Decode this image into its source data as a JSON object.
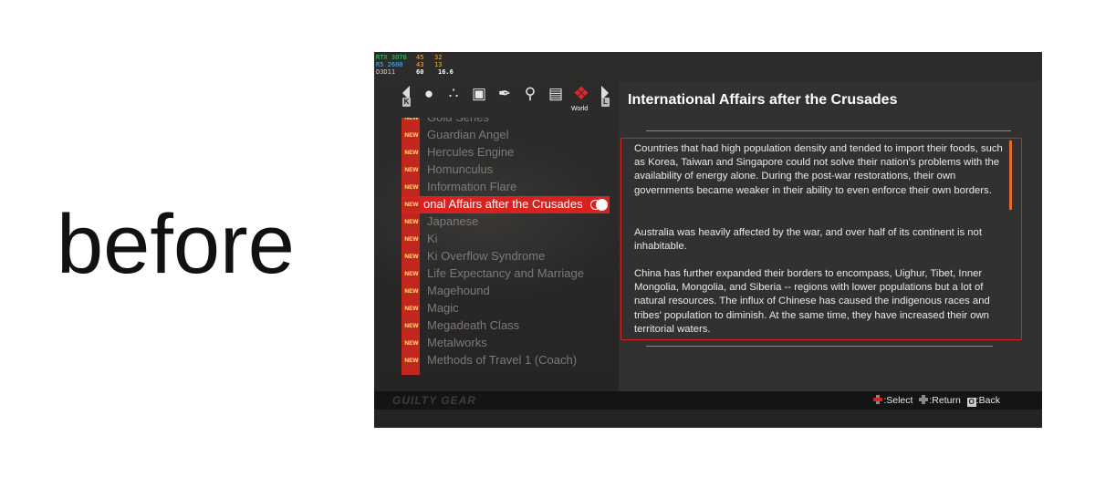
{
  "caption": "before",
  "perf": {
    "gpu": "RTX 3070",
    "gpu_temp": "45",
    "gpu_load": "32",
    "cpu": "R5 2600",
    "cpu_temp": "43",
    "cpu_load": "13",
    "api": "D3D11",
    "fps": "60",
    "frametime": "16.6"
  },
  "nav": {
    "left_key": "K",
    "right_key": "L",
    "active_category": "World",
    "icons": [
      "character-icon",
      "network-icon",
      "gallery-icon",
      "feather-icon",
      "magnifier-icon",
      "scroll-icon",
      "world-icon"
    ]
  },
  "list": {
    "badge": "NEW",
    "items": [
      "Gold Series",
      "Guardian Angel",
      "Hercules Engine",
      "Homunculus",
      "Information Flare",
      "onal Affairs after the Crusades",
      "Japanese",
      "Ki",
      "Ki Overflow Syndrome",
      "Life Expectancy and Marriage",
      "Magehound",
      "Magic",
      "Megadeath Class",
      "Metalworks",
      "Methods of Travel 1 (Coach)"
    ],
    "selected_index": 5
  },
  "article": {
    "title": "International Affairs after the Crusades",
    "paragraphs": [
      "Countries that had high population density and tended to import their foods, such as Korea, Taiwan and Singapore could not solve their nation's problems with the availability of energy alone. During the post-war restorations, their own governments became weaker in their ability to even enforce their own borders.",
      "Australia was heavily affected by the war, and over half of its continent is not inhabitable.",
      "China has further expanded their borders to encompass, Uighur, Tibet, Inner Mongolia, Mongolia, and Siberia -- regions with lower populations but a lot of natural resources. The influx of Chinese has caused the indigenous races and tribes' population to diminish. At the same time, they have increased their own territorial waters."
    ]
  },
  "footer": {
    "logo": "GUILTY GEAR",
    "select": ":Select",
    "return": ":Return",
    "back": ":Back",
    "back_key": "O"
  },
  "colors": {
    "accent_red": "#d7231f",
    "badge_text": "#ffe36b",
    "scroll": "#e36a2c"
  }
}
